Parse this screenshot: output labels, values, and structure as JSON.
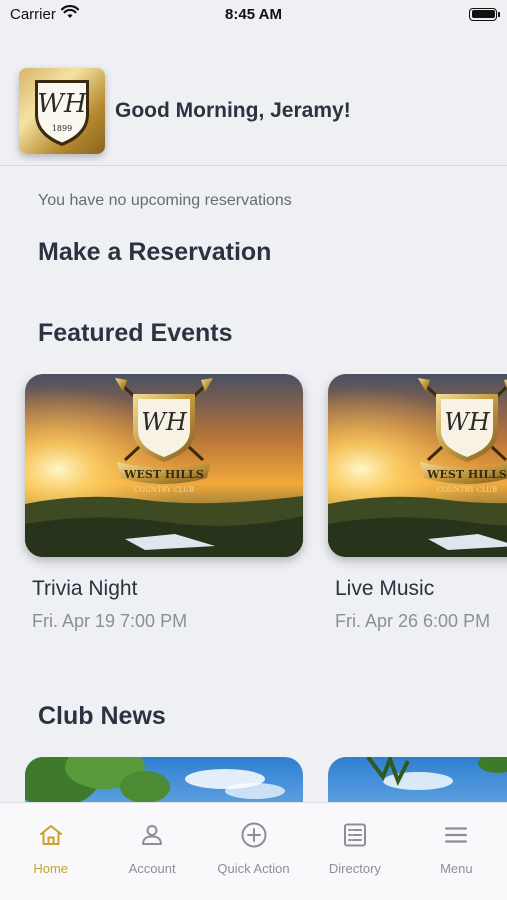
{
  "status_bar": {
    "carrier": "Carrier",
    "time": "8:45 AM",
    "battery_level": 1.0
  },
  "header": {
    "greeting": "Good Morning, Jeramy!",
    "logo_icon": "club-crest-logo",
    "logo_year": "1899"
  },
  "reservations": {
    "empty_message": "You have no upcoming reservations",
    "make_title": "Make a Reservation"
  },
  "featured_events": {
    "title": "Featured Events",
    "items": [
      {
        "title": "Trivia Night",
        "date": "Fri. Apr 19 7:00 PM"
      },
      {
        "title": "Live Music",
        "date": "Fri. Apr 26 6:00 PM"
      }
    ]
  },
  "club_news": {
    "title": "Club News"
  },
  "tab_bar": {
    "active_color": "#c9a227",
    "items": [
      {
        "label": "Home",
        "icon": "home-icon"
      },
      {
        "label": "Account",
        "icon": "account-icon"
      },
      {
        "label": "Quick Action",
        "icon": "plus-circle-icon"
      },
      {
        "label": "Directory",
        "icon": "directory-icon"
      },
      {
        "label": "Menu",
        "icon": "hamburger-menu-icon"
      }
    ]
  }
}
